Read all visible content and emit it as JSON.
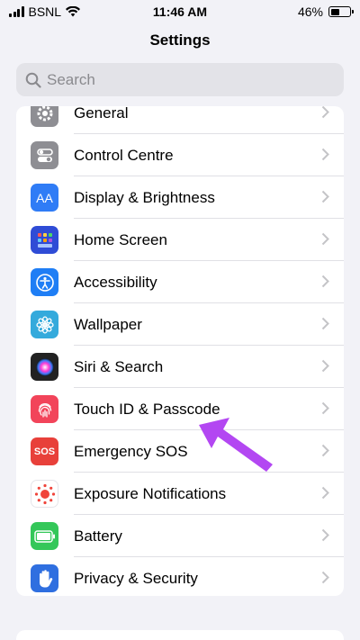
{
  "status": {
    "carrier": "BSNL",
    "time": "11:46 AM",
    "battery": "46%",
    "battery_level": 0.46
  },
  "nav": {
    "title": "Settings"
  },
  "search": {
    "placeholder": "Search"
  },
  "settings_items": [
    {
      "label": "General",
      "icon": "gear-icon",
      "color": "#8e8e93"
    },
    {
      "label": "Control Centre",
      "icon": "toggles-icon",
      "color": "#8e8e93"
    },
    {
      "label": "Display & Brightness",
      "icon": "text-size-icon",
      "color": "#2f7cf6"
    },
    {
      "label": "Home Screen",
      "icon": "app-grid-icon",
      "color": "#2f4cd6"
    },
    {
      "label": "Accessibility",
      "icon": "accessibility-icon",
      "color": "#1f7ef5"
    },
    {
      "label": "Wallpaper",
      "icon": "flower-icon",
      "color": "#34aadc"
    },
    {
      "label": "Siri & Search",
      "icon": "siri-icon",
      "color": "#222222"
    },
    {
      "label": "Touch ID & Passcode",
      "icon": "fingerprint-icon",
      "color": "#f2445a"
    },
    {
      "label": "Emergency SOS",
      "icon": "sos-icon",
      "color": "#e8403a"
    },
    {
      "label": "Exposure Notifications",
      "icon": "exposure-icon",
      "color": "#ffffff"
    },
    {
      "label": "Battery",
      "icon": "battery-icon",
      "color": "#34c759"
    },
    {
      "label": "Privacy & Security",
      "icon": "hand-icon",
      "color": "#2f6fe0"
    }
  ],
  "sos_text": "SOS",
  "aa_text": "AA",
  "annotation": {
    "arrow_color": "#b347f2"
  }
}
